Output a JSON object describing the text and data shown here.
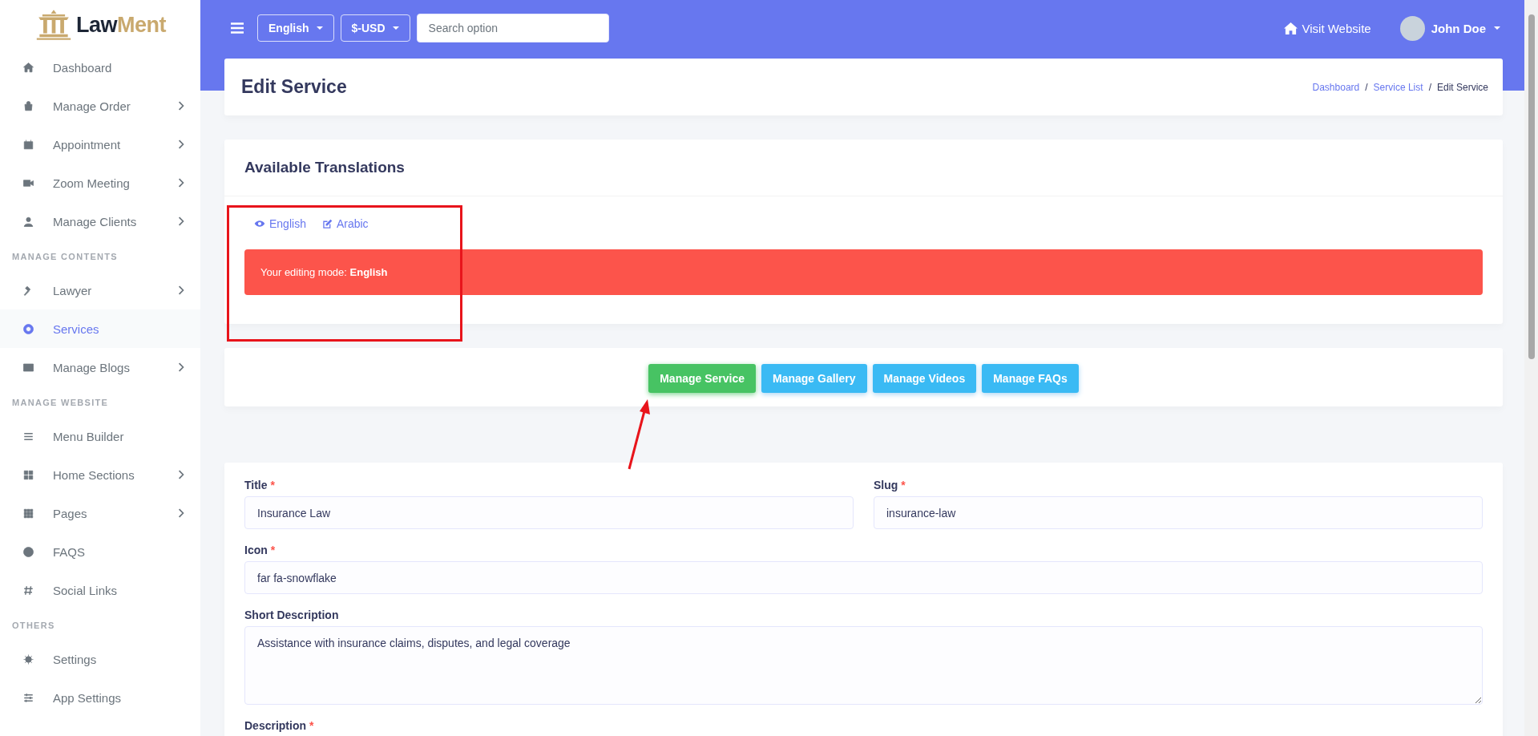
{
  "brand": {
    "name_primary": "Law",
    "name_accent": "Ment"
  },
  "sidebar": {
    "sections": [
      {
        "items": [
          {
            "label": "Dashboard",
            "has_submenu": false,
            "selected": false
          },
          {
            "label": "Manage Order",
            "has_submenu": true,
            "selected": false
          },
          {
            "label": "Appointment",
            "has_submenu": true,
            "selected": false
          },
          {
            "label": "Zoom Meeting",
            "has_submenu": true,
            "selected": false
          },
          {
            "label": "Manage Clients",
            "has_submenu": true,
            "selected": false
          }
        ]
      },
      {
        "heading": "MANAGE CONTENTS",
        "items": [
          {
            "label": "Lawyer",
            "has_submenu": true,
            "selected": false
          },
          {
            "label": "Services",
            "has_submenu": false,
            "selected": true
          },
          {
            "label": "Manage Blogs",
            "has_submenu": true,
            "selected": false
          }
        ]
      },
      {
        "heading": "MANAGE WEBSITE",
        "items": [
          {
            "label": "Menu Builder",
            "has_submenu": false,
            "selected": false
          },
          {
            "label": "Home Sections",
            "has_submenu": true,
            "selected": false
          },
          {
            "label": "Pages",
            "has_submenu": true,
            "selected": false
          },
          {
            "label": "FAQS",
            "has_submenu": false,
            "selected": false
          },
          {
            "label": "Social Links",
            "has_submenu": false,
            "selected": false
          }
        ]
      },
      {
        "heading": "OTHERS",
        "items": [
          {
            "label": "Settings",
            "has_submenu": false,
            "selected": false
          },
          {
            "label": "App Settings",
            "has_submenu": false,
            "selected": false
          }
        ]
      }
    ]
  },
  "topbar": {
    "language": "English",
    "currency": "$-USD",
    "search": {
      "placeholder": "Search option"
    },
    "visit_website": "Visit Website",
    "user": "John Doe"
  },
  "page": {
    "title": "Edit Service",
    "breadcrumb_separator": "/",
    "breadcrumbs": [
      {
        "label": "Dashboard",
        "kind": "link"
      },
      {
        "label": "Service List",
        "kind": "link"
      },
      {
        "label": "Edit Service",
        "kind": "current"
      }
    ]
  },
  "translations": {
    "title": "Available Translations",
    "languages": [
      {
        "label": "English",
        "kind": "view"
      },
      {
        "label": "Arabic",
        "kind": "edit"
      }
    ],
    "alert": "Your editing mode: **English**"
  },
  "tabs": [
    {
      "label": "Manage Service",
      "selected": true
    },
    {
      "label": "Manage Gallery",
      "selected": false
    },
    {
      "label": "Manage Videos",
      "selected": false
    },
    {
      "label": "Manage FAQs",
      "selected": false
    }
  ],
  "form": {
    "rows": [
      [
        {
          "label": "Title",
          "required_mark": "*",
          "kind": "input",
          "value": "Insurance Law"
        },
        {
          "label": "Slug",
          "required_mark": "*",
          "kind": "input",
          "value": "insurance-law"
        }
      ],
      [
        {
          "label": "Icon",
          "required_mark": "*",
          "kind": "input",
          "value": "far fa-snowflake"
        }
      ],
      [
        {
          "label": "Short Description",
          "kind": "textarea",
          "value": "Assistance with insurance claims, disputes, and legal coverage"
        }
      ],
      [
        {
          "label": "Description",
          "required_mark": "*",
          "kind": "label"
        }
      ]
    ]
  }
}
